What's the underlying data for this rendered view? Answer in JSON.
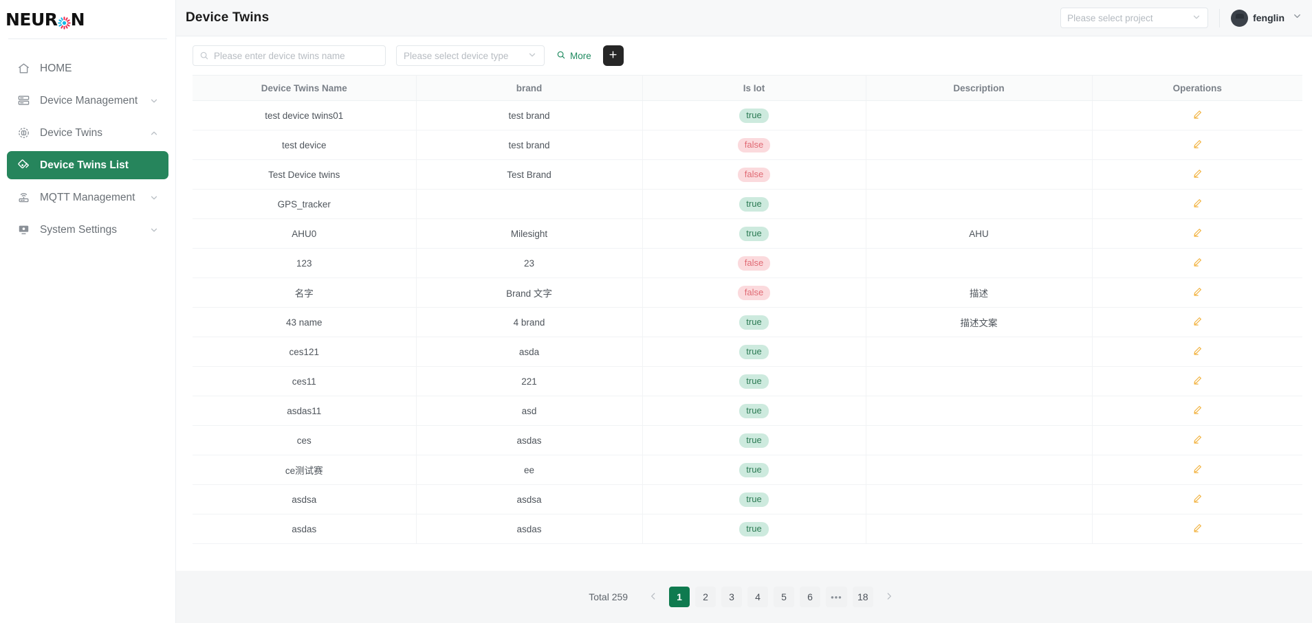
{
  "brand": {
    "logo_text_left": "NEUR",
    "logo_text_right": "N",
    "logo_icon": "starburst-icon"
  },
  "colors": {
    "accent_green": "#26855c",
    "pagination_active": "#0f7a4f",
    "badge_true_bg": "#cdeade",
    "badge_true_text": "#2b7a53",
    "badge_false_bg": "#fbdadd",
    "badge_false_text": "#e06a74",
    "edit_icon": "#f2b23e",
    "add_button_bg": "#262626"
  },
  "sidebar": {
    "items": [
      {
        "label": "HOME",
        "icon": "home-icon",
        "has_caret": false,
        "active": false
      },
      {
        "label": "Device Management",
        "icon": "server-icon",
        "has_caret": true,
        "caret": "chevron-down-icon",
        "active": false
      },
      {
        "label": "Device Twins",
        "icon": "device-twins-icon",
        "has_caret": true,
        "caret": "chevron-up-icon",
        "active": false
      },
      {
        "label": "Device Twins List",
        "icon": "layers-diamond-icon",
        "has_caret": false,
        "active": true
      },
      {
        "label": "MQTT Management",
        "icon": "router-icon",
        "has_caret": true,
        "caret": "chevron-down-icon",
        "active": false
      },
      {
        "label": "System Settings",
        "icon": "monitor-icon",
        "has_caret": true,
        "caret": "chevron-down-icon",
        "active": false
      }
    ]
  },
  "topbar": {
    "title": "Device Twins",
    "project_select_placeholder": "Please select project",
    "project_select_value": "",
    "user_name": "fenglin",
    "user_caret_icon": "chevron-down-icon",
    "avatar_icon": "avatar"
  },
  "toolbar": {
    "search_placeholder": "Please enter device twins name",
    "search_value": "",
    "search_icon": "search-icon",
    "device_type_placeholder": "Please select device type",
    "device_type_value": "",
    "device_type_caret": "chevron-down-icon",
    "more_label": "More",
    "more_icon": "search-icon",
    "add_label": "+",
    "add_icon": "plus-icon"
  },
  "table": {
    "columns": [
      {
        "key": "name",
        "label": "Device Twins Name"
      },
      {
        "key": "brand",
        "label": "brand"
      },
      {
        "key": "is_iot",
        "label": "Is Iot"
      },
      {
        "key": "description",
        "label": "Description"
      },
      {
        "key": "operations",
        "label": "Operations"
      }
    ],
    "rows": [
      {
        "name": "test device twins01",
        "brand": "test brand",
        "is_iot": "true",
        "description": ""
      },
      {
        "name": "test device",
        "brand": "test brand",
        "is_iot": "false",
        "description": ""
      },
      {
        "name": "Test Device twins",
        "brand": "Test Brand",
        "is_iot": "false",
        "description": ""
      },
      {
        "name": "GPS_tracker",
        "brand": "",
        "is_iot": "true",
        "description": ""
      },
      {
        "name": "AHU0",
        "brand": "Milesight",
        "is_iot": "true",
        "description": "AHU"
      },
      {
        "name": "123",
        "brand": "23",
        "is_iot": "false",
        "description": ""
      },
      {
        "name": "名字",
        "brand": "Brand 文字",
        "is_iot": "false",
        "description": "描述"
      },
      {
        "name": "43 name",
        "brand": "4 brand",
        "is_iot": "true",
        "description": "描述文案"
      },
      {
        "name": "ces121",
        "brand": "asda",
        "is_iot": "true",
        "description": ""
      },
      {
        "name": "ces11",
        "brand": "221",
        "is_iot": "true",
        "description": ""
      },
      {
        "name": "asdas11",
        "brand": "asd",
        "is_iot": "true",
        "description": ""
      },
      {
        "name": "ces",
        "brand": "asdas",
        "is_iot": "true",
        "description": ""
      },
      {
        "name": "ce测试赛",
        "brand": "ee",
        "is_iot": "true",
        "description": ""
      },
      {
        "name": "asdsa",
        "brand": "asdsa",
        "is_iot": "true",
        "description": ""
      },
      {
        "name": "asdas",
        "brand": "asdas",
        "is_iot": "true",
        "description": ""
      }
    ],
    "row_action_icon": "edit-pencil-icon"
  },
  "pagination": {
    "total_label": "Total 259",
    "prev_icon": "chevron-left-icon",
    "next_icon": "chevron-right-icon",
    "pages": [
      "1",
      "2",
      "3",
      "4",
      "5",
      "6",
      "•••",
      "18"
    ],
    "current_page": "1"
  }
}
